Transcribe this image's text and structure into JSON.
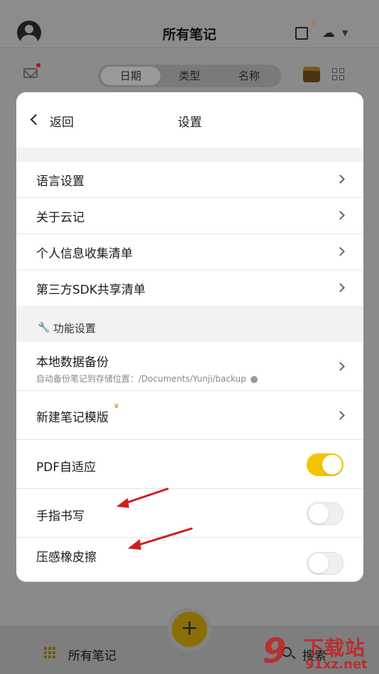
{
  "app": {
    "title": "所有笔记",
    "segments": [
      "日期",
      "类型",
      "名称"
    ],
    "active_segment": "日期"
  },
  "dialog": {
    "back_label": "返回",
    "title": "设置",
    "rows_general": [
      {
        "label": "语言设置"
      },
      {
        "label": "关于云记"
      },
      {
        "label": "个人信息收集清单"
      },
      {
        "label": "第三方SDK共享清单"
      }
    ],
    "section_title": "功能设置",
    "backup": {
      "label": "本地数据备份",
      "sub": "自动备份笔记到存储位置：/Documents/Yunji/backup"
    },
    "template": {
      "label": "新建笔记模版"
    },
    "pdf_adapt": {
      "label": "PDF自适应",
      "enabled": true
    },
    "finger_write": {
      "label": "手指书写",
      "enabled": false
    },
    "pressure_eraser": {
      "label": "压感橡皮擦",
      "enabled": false
    }
  },
  "bottom": {
    "left_label": "所有笔记",
    "right_label": "搜索",
    "fab_symbol": "+"
  },
  "watermark": {
    "logo": "9",
    "text": "下载站",
    "url": "91xz.net"
  },
  "colors": {
    "accent": "#f5c400",
    "annotation": "#d21c1c"
  }
}
